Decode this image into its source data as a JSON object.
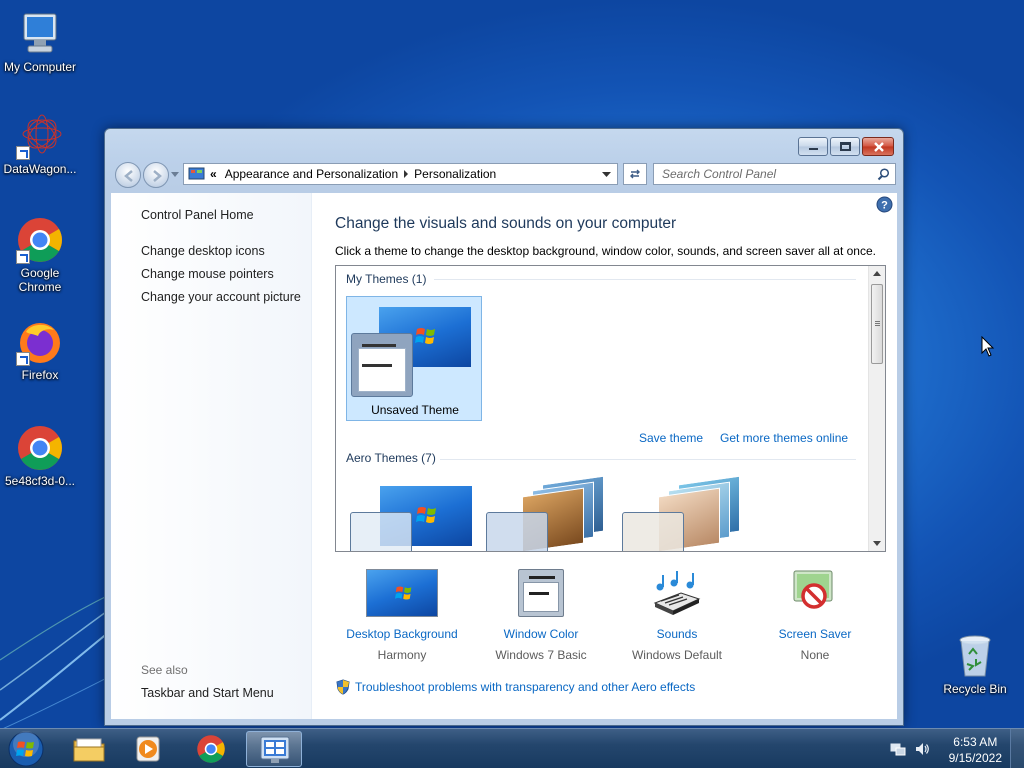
{
  "desktop": {
    "icons": [
      {
        "label": "My Computer",
        "icon": "computer-icon"
      },
      {
        "label": "DataWagon...",
        "icon": "datawagon-icon"
      },
      {
        "label": "Google Chrome",
        "icon": "chrome-icon"
      },
      {
        "label": "Firefox",
        "icon": "firefox-icon"
      },
      {
        "label": "5e48cf3d-0...",
        "icon": "chrome-icon"
      },
      {
        "label": "Recycle Bin",
        "icon": "recycle-bin-icon"
      }
    ]
  },
  "window": {
    "address": {
      "overflow": "«",
      "crumbs": [
        "Appearance and Personalization",
        "Personalization"
      ]
    },
    "search_placeholder": "Search Control Panel",
    "left_pane": {
      "home": "Control Panel Home",
      "links": [
        "Change desktop icons",
        "Change mouse pointers",
        "Change your account picture"
      ],
      "see_also": "See also",
      "see_also_links": [
        "Taskbar and Start Menu"
      ]
    },
    "main": {
      "title": "Change the visuals and sounds on your computer",
      "subtitle": "Click a theme to change the desktop background, window color, sounds, and screen saver all at once.",
      "my_themes_header": "My Themes (1)",
      "unsaved_theme": "Unsaved Theme",
      "save_theme": "Save theme",
      "get_more": "Get more themes online",
      "aero_header": "Aero Themes (7)",
      "bottom": [
        {
          "title": "Desktop Background",
          "value": "Harmony",
          "icon": "desktop-background-icon"
        },
        {
          "title": "Window Color",
          "value": "Windows 7 Basic",
          "icon": "window-color-icon"
        },
        {
          "title": "Sounds",
          "value": "Windows Default",
          "icon": "sounds-icon"
        },
        {
          "title": "Screen Saver",
          "value": "None",
          "icon": "screen-saver-icon"
        }
      ],
      "troubleshoot": "Troubleshoot problems with transparency and other Aero effects"
    }
  },
  "taskbar": {
    "time": "6:53 AM",
    "date": "9/15/2022",
    "buttons": [
      "start-button",
      "explorer",
      "media-player",
      "chrome",
      "control-panel"
    ]
  }
}
